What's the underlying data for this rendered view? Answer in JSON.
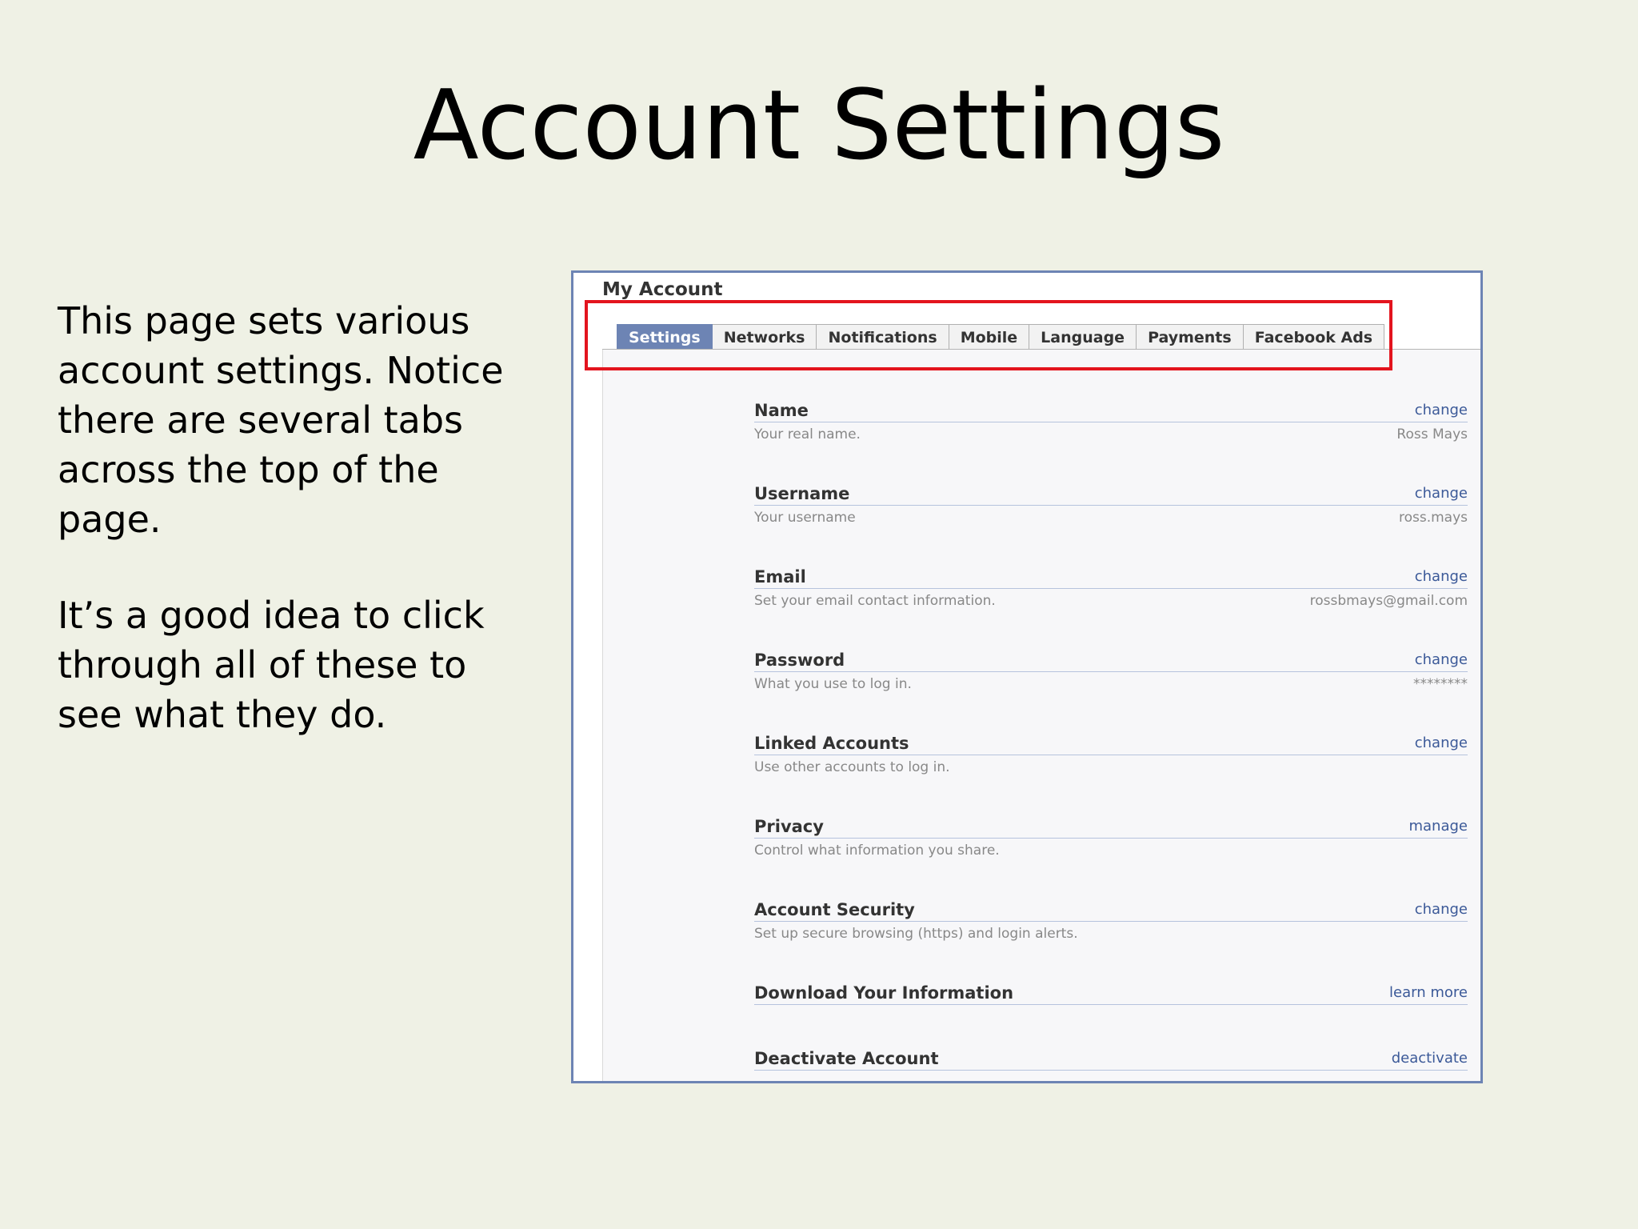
{
  "slide": {
    "title": "Account Settings",
    "paragraphs": [
      "This page sets various account settings.  Notice there are several tabs across the top of the page.",
      "It’s a good idea to click through all of these to see what they do."
    ]
  },
  "account": {
    "heading": "My Account",
    "tabs": [
      {
        "label": "Settings",
        "active": true
      },
      {
        "label": "Networks",
        "active": false
      },
      {
        "label": "Notifications",
        "active": false
      },
      {
        "label": "Mobile",
        "active": false
      },
      {
        "label": "Language",
        "active": false
      },
      {
        "label": "Payments",
        "active": false
      },
      {
        "label": "Facebook Ads",
        "active": false
      }
    ],
    "rows": [
      {
        "label": "Name",
        "action": "change",
        "desc": "Your real name.",
        "value": "Ross Mays"
      },
      {
        "label": "Username",
        "action": "change",
        "desc": "Your username",
        "value": "ross.mays"
      },
      {
        "label": "Email",
        "action": "change",
        "desc": "Set your email contact information.",
        "value": "rossbmays@gmail.com"
      },
      {
        "label": "Password",
        "action": "change",
        "desc": "What you use to log in.",
        "value": "********"
      },
      {
        "label": "Linked Accounts",
        "action": "change",
        "desc": "Use other accounts to log in.",
        "value": ""
      },
      {
        "label": "Privacy",
        "action": "manage",
        "desc": "Control what information you share.",
        "value": ""
      },
      {
        "label": "Account Security",
        "action": "change",
        "desc": "Set up secure browsing (https) and login alerts.",
        "value": ""
      },
      {
        "label": "Download Your Information",
        "action": "learn more",
        "desc": "",
        "value": ""
      },
      {
        "label": "Deactivate Account",
        "action": "deactivate",
        "desc": "",
        "value": ""
      }
    ]
  },
  "colors": {
    "background": "#eff1e5",
    "tab_active": "#6d84b4",
    "link": "#3b5998",
    "highlight": "#e3141e"
  }
}
